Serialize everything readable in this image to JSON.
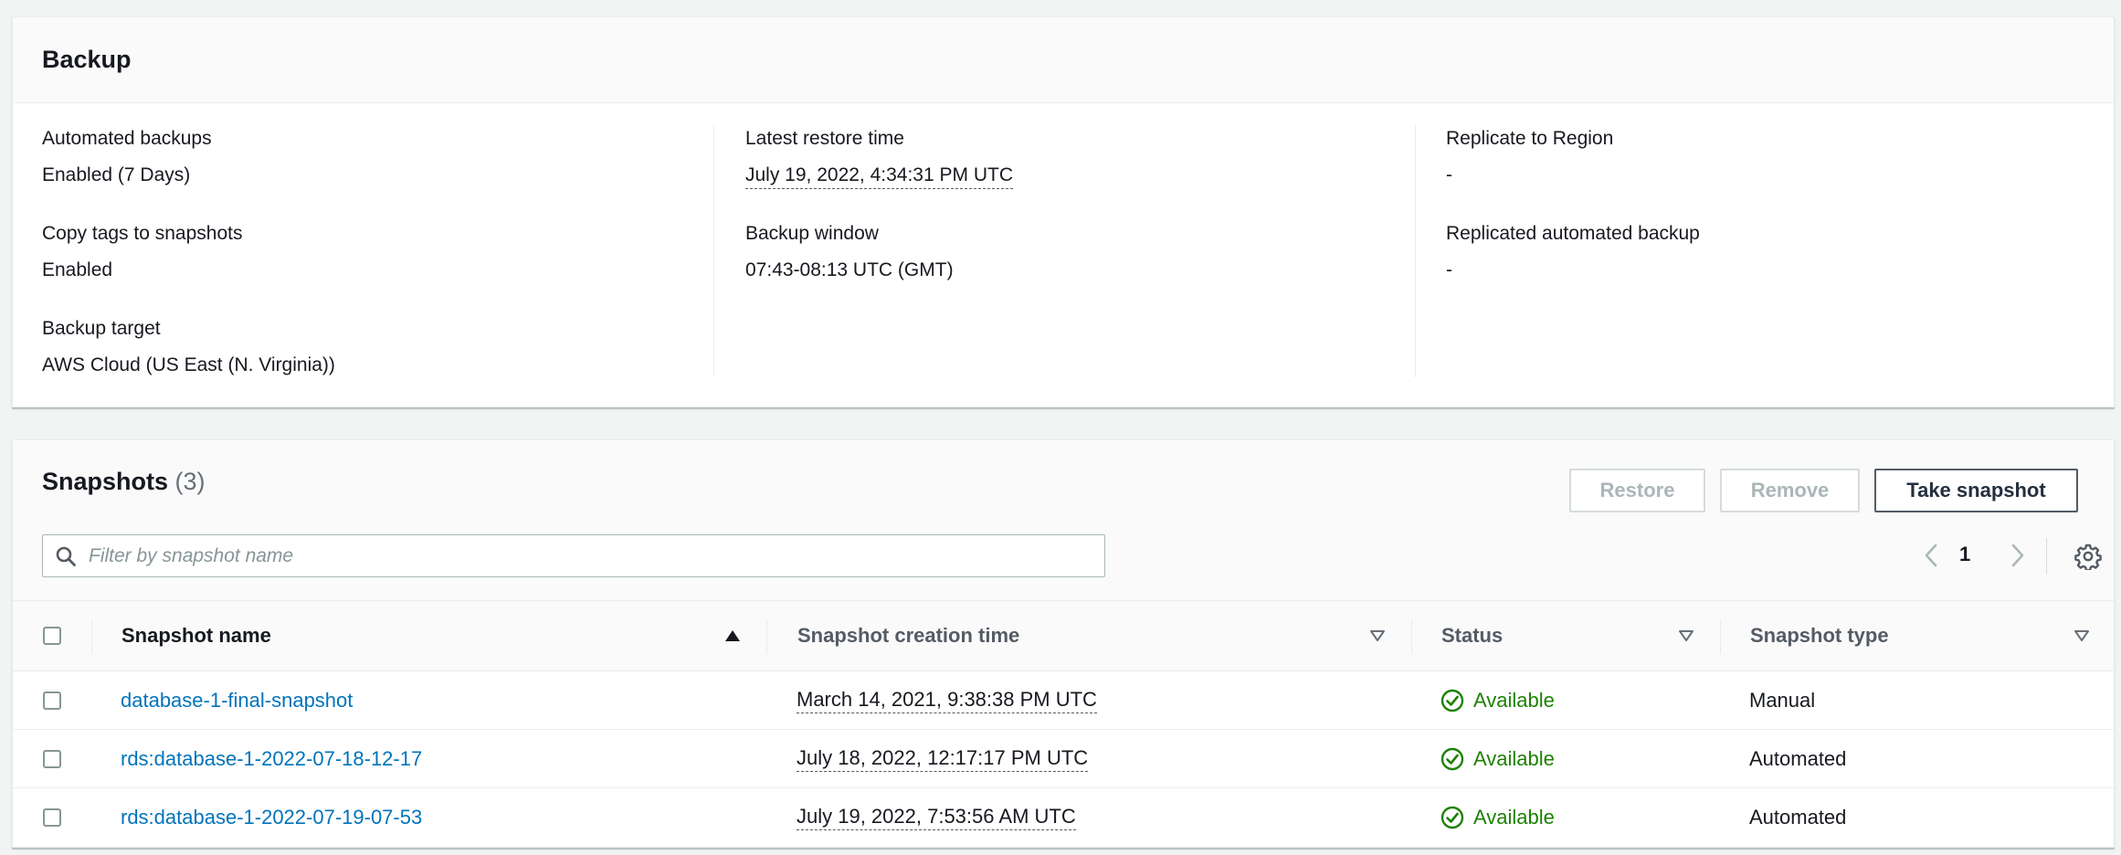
{
  "backup": {
    "title": "Backup",
    "columns": [
      [
        {
          "label": "Automated backups",
          "value": "Enabled (7 Days)"
        },
        {
          "label": "Copy tags to snapshots",
          "value": "Enabled"
        },
        {
          "label": "Backup target",
          "value": "AWS Cloud (US East (N. Virginia))"
        }
      ],
      [
        {
          "label": "Latest restore time",
          "value": "July 19, 2022, 4:34:31 PM UTC"
        },
        {
          "label": "Backup window",
          "value": "07:43-08:13 UTC (GMT)"
        }
      ],
      [
        {
          "label": "Replicate to Region",
          "value": "-"
        },
        {
          "label": "Replicated automated backup",
          "value": "-"
        }
      ]
    ]
  },
  "snapshots": {
    "title": "Snapshots",
    "count": "(3)",
    "buttons": {
      "restore": "Restore",
      "remove": "Remove",
      "take": "Take snapshot"
    },
    "filter_placeholder": "Filter by snapshot name",
    "page": "1",
    "columns": {
      "name": "Snapshot name",
      "creation_time": "Snapshot creation time",
      "status": "Status",
      "type": "Snapshot type"
    },
    "rows": [
      {
        "name": "database-1-final-snapshot",
        "time": "March 14, 2021, 9:38:38 PM UTC",
        "status": "Available",
        "type": "Manual"
      },
      {
        "name": "rds:database-1-2022-07-18-12-17",
        "time": "July 18, 2022, 12:17:17 PM UTC",
        "status": "Available",
        "type": "Automated"
      },
      {
        "name": "rds:database-1-2022-07-19-07-53",
        "time": "July 19, 2022, 7:53:56 AM UTC",
        "status": "Available",
        "type": "Automated"
      }
    ]
  },
  "colors": {
    "link": "#0073bb",
    "success": "#1d8102",
    "text": "#16191f"
  }
}
